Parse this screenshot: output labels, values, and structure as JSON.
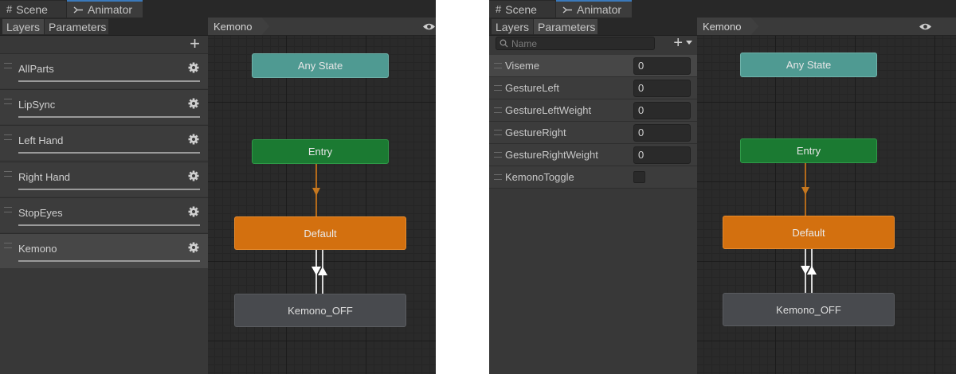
{
  "windows": [
    {
      "tabs": {
        "scene": "Scene",
        "animator": "Animator"
      },
      "panel_tabs": {
        "layers": "Layers",
        "parameters": "Parameters"
      },
      "active_panel": "layers",
      "add_label": "+",
      "layers": [
        {
          "name": "AllParts"
        },
        {
          "name": "LipSync"
        },
        {
          "name": "Left Hand"
        },
        {
          "name": "Right Hand"
        },
        {
          "name": "StopEyes"
        },
        {
          "name": "Kemono",
          "selected": true
        }
      ],
      "breadcrumb": "Kemono",
      "states": {
        "any": "Any State",
        "entry": "Entry",
        "default": "Default",
        "off": "Kemono_OFF"
      }
    },
    {
      "tabs": {
        "scene": "Scene",
        "animator": "Animator"
      },
      "panel_tabs": {
        "layers": "Layers",
        "parameters": "Parameters"
      },
      "active_panel": "parameters",
      "add_label": "+",
      "search_placeholder": "Name",
      "parameters": [
        {
          "name": "Viseme",
          "type": "int",
          "value": "0",
          "selected": true
        },
        {
          "name": "GestureLeft",
          "type": "int",
          "value": "0"
        },
        {
          "name": "GestureLeftWeight",
          "type": "float",
          "value": "0"
        },
        {
          "name": "GestureRight",
          "type": "int",
          "value": "0"
        },
        {
          "name": "GestureRightWeight",
          "type": "float",
          "value": "0"
        },
        {
          "name": "KemonoToggle",
          "type": "bool",
          "checked": false
        }
      ],
      "breadcrumb": "Kemono",
      "states": {
        "any": "Any State",
        "entry": "Entry",
        "default": "Default",
        "off": "Kemono_OFF"
      }
    }
  ],
  "colors": {
    "any_state": "#4f9a92",
    "entry": "#1b7a32",
    "default": "#d3700f",
    "state": "#484a4e",
    "tab_accent": "#3a79bb",
    "transition_entry": "#b36a1a"
  }
}
